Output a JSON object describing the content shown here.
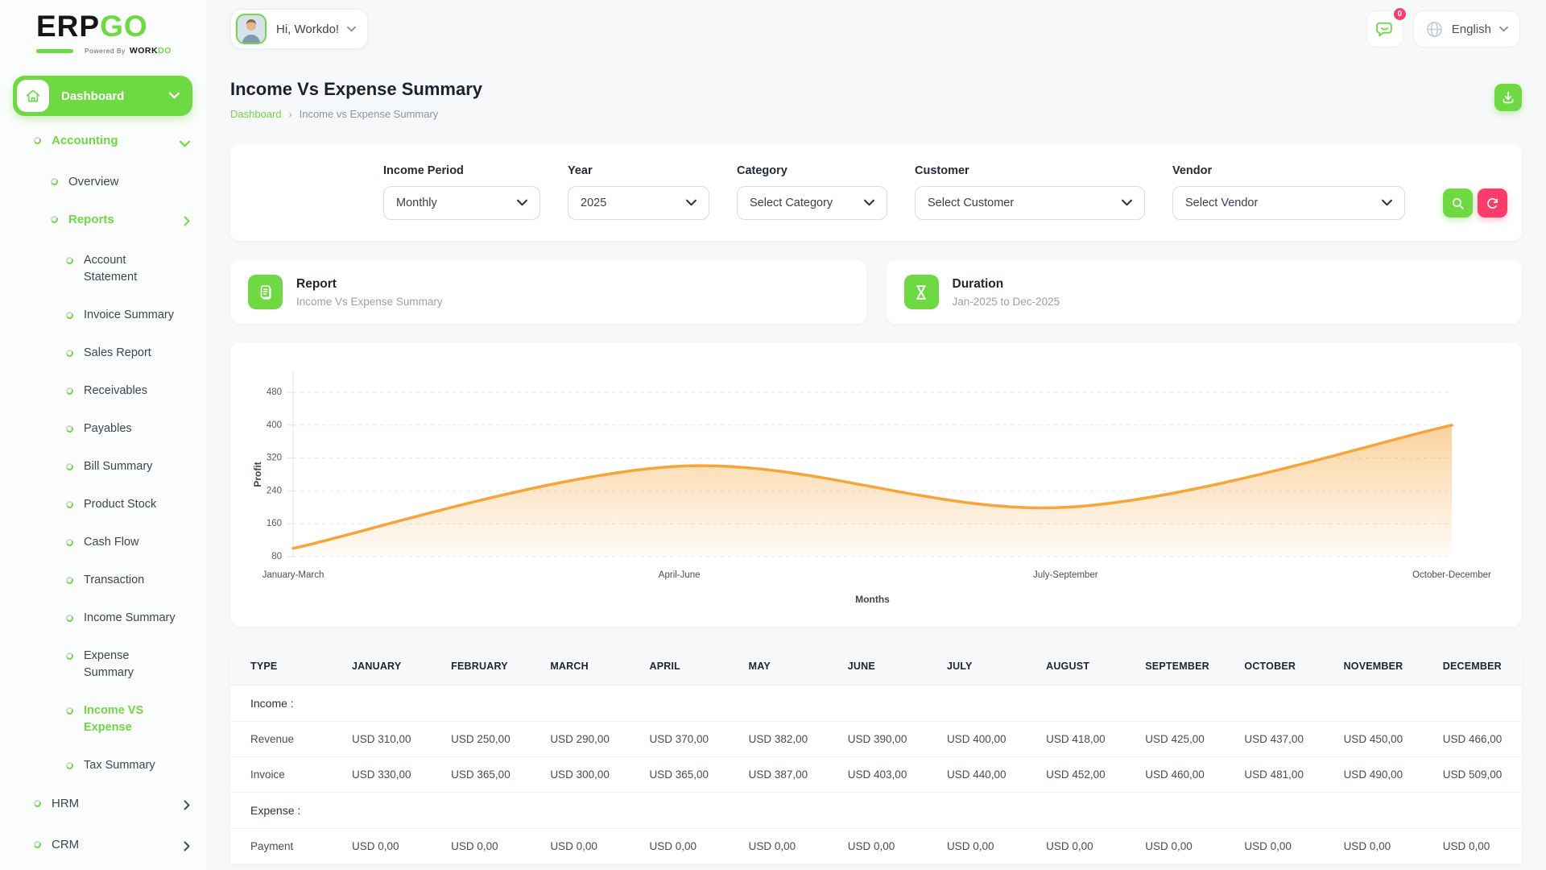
{
  "brand": {
    "name_primary": "ERP",
    "name_accent": "GO",
    "powered_prefix": "Powered By",
    "powered_name_dark": "WORK",
    "powered_name_accent": "DO"
  },
  "topbar": {
    "greeting": "Hi, Workdo!",
    "notification_badge": "0",
    "language": "English"
  },
  "sidebar": {
    "dashboard_label": "Dashboard",
    "items": [
      {
        "label": "Accounting",
        "level": 1,
        "active": true,
        "chevron": "down"
      },
      {
        "label": "Overview",
        "level": 2
      },
      {
        "label": "Reports",
        "level": 2,
        "active": true,
        "chevron": "right"
      },
      {
        "label": "Account Statement",
        "level": 3
      },
      {
        "label": "Invoice Summary",
        "level": 3
      },
      {
        "label": "Sales Report",
        "level": 3
      },
      {
        "label": "Receivables",
        "level": 3
      },
      {
        "label": "Payables",
        "level": 3
      },
      {
        "label": "Bill Summary",
        "level": 3
      },
      {
        "label": "Product Stock",
        "level": 3
      },
      {
        "label": "Cash Flow",
        "level": 3
      },
      {
        "label": "Transaction",
        "level": 3
      },
      {
        "label": "Income Summary",
        "level": 3
      },
      {
        "label": "Expense Summary",
        "level": 3
      },
      {
        "label": "Income VS Expense",
        "level": 3,
        "active": true
      },
      {
        "label": "Tax Summary",
        "level": 3
      },
      {
        "label": "HRM",
        "level": 1,
        "chevron": "right"
      },
      {
        "label": "CRM",
        "level": 1,
        "chevron": "right"
      }
    ]
  },
  "page": {
    "title": "Income Vs Expense Summary",
    "breadcrumb": [
      "Dashboard",
      "Income vs Expense Summary"
    ]
  },
  "filters": {
    "groups": [
      {
        "label": "Income Period",
        "value": "Monthly"
      },
      {
        "label": "Year",
        "value": "2025"
      },
      {
        "label": "Category",
        "value": "Select Category"
      },
      {
        "label": "Customer",
        "value": "Select Customer"
      },
      {
        "label": "Vendor",
        "value": "Select Vendor"
      }
    ]
  },
  "summary_cards": {
    "report": {
      "title": "Report",
      "subtitle": "Income Vs Expense Summary"
    },
    "duration": {
      "title": "Duration",
      "subtitle": "Jan-2025 to Dec-2025"
    }
  },
  "chart_data": {
    "type": "area",
    "x": [
      "January-March",
      "April-June",
      "July-September",
      "October-December"
    ],
    "series": [
      {
        "name": "Profit",
        "values": [
          100,
          300,
          200,
          400
        ]
      }
    ],
    "title": "",
    "xlabel": "Months",
    "ylabel": "Profit",
    "ylim": [
      80,
      480
    ],
    "yticks": [
      80,
      160,
      240,
      320,
      400,
      480
    ],
    "grid": "horizontal-dashed",
    "legend": "none",
    "line_color": "#f7a53a",
    "fill": "orange-gradient-to-transparent"
  },
  "table": {
    "type_header": "TYPE",
    "month_headers": [
      "JANUARY",
      "FEBRUARY",
      "MARCH",
      "APRIL",
      "MAY",
      "JUNE",
      "JULY",
      "AUGUST",
      "SEPTEMBER",
      "OCTOBER",
      "NOVEMBER",
      "DECEMBER"
    ],
    "rows": [
      {
        "kind": "section",
        "label": "Income :"
      },
      {
        "kind": "data",
        "label": "Revenue",
        "values": [
          "USD 310,00",
          "USD 250,00",
          "USD 290,00",
          "USD 370,00",
          "USD 382,00",
          "USD 390,00",
          "USD 400,00",
          "USD 418,00",
          "USD 425,00",
          "USD 437,00",
          "USD 450,00",
          "USD 466,00"
        ]
      },
      {
        "kind": "data",
        "label": "Invoice",
        "values": [
          "USD 330,00",
          "USD 365,00",
          "USD 300,00",
          "USD 365,00",
          "USD 387,00",
          "USD 403,00",
          "USD 440,00",
          "USD 452,00",
          "USD 460,00",
          "USD 481,00",
          "USD 490,00",
          "USD 509,00"
        ]
      },
      {
        "kind": "section",
        "label": "Expense :"
      },
      {
        "kind": "data",
        "label": "Payment",
        "values": [
          "USD 0,00",
          "USD 0,00",
          "USD 0,00",
          "USD 0,00",
          "USD 0,00",
          "USD 0,00",
          "USD 0,00",
          "USD 0,00",
          "USD 0,00",
          "USD 0,00",
          "USD 0,00",
          "USD 0,00"
        ]
      }
    ]
  },
  "colors": {
    "accent_green": "#6fd943",
    "badge_pink": "#fd3c6c",
    "chart_orange": "#f7a53a"
  }
}
